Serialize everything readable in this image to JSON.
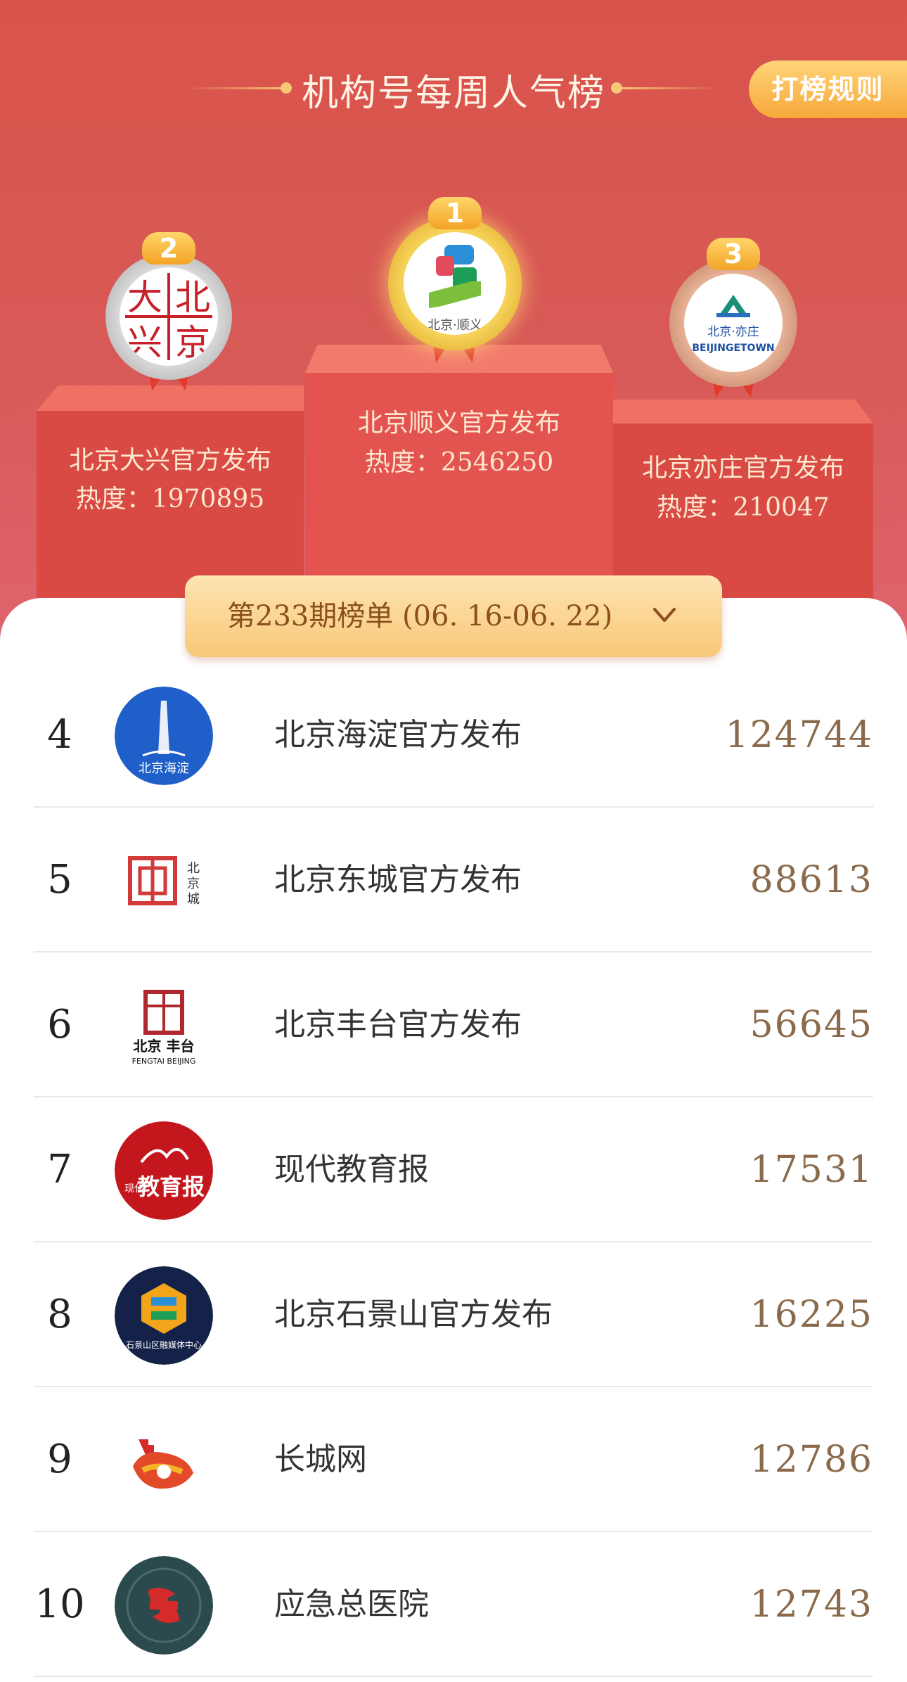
{
  "header": {
    "title": "机构号每周人气榜",
    "rules_label": "打榜规则"
  },
  "podium": {
    "first": {
      "rank": "1",
      "name": "北京顺义官方发布",
      "heat_label": "热度：2546250",
      "logo_text": "北京·顺义"
    },
    "second": {
      "rank": "2",
      "name": "北京大兴官方发布",
      "heat_label": "热度：1970895",
      "logo_chars": [
        "大",
        "北",
        "兴",
        "京"
      ]
    },
    "third": {
      "rank": "3",
      "name": "北京亦庄官方发布",
      "heat_label": "热度：210047",
      "logo_text": "北京·亦庄",
      "logo_sub": "BEIJINGETOWN"
    }
  },
  "period": {
    "label": "第233期榜单 (06. 16-06. 22)"
  },
  "list": [
    {
      "rank": "4",
      "name": "北京海淀官方发布",
      "heat": "124744",
      "logo_text": "北京海淀",
      "icon": "haidian-logo-icon"
    },
    {
      "rank": "5",
      "name": "北京东城官方发布",
      "heat": "88613",
      "logo_text": "北京·东城",
      "icon": "dongcheng-logo-icon"
    },
    {
      "rank": "6",
      "name": "北京丰台官方发布",
      "heat": "56645",
      "logo_text": "北京 丰台",
      "logo_sub": "FENGTAI BEIJING",
      "icon": "fengtai-logo-icon"
    },
    {
      "rank": "7",
      "name": "现代教育报",
      "heat": "17531",
      "logo_text": "教育报",
      "logo_small": "现代",
      "icon": "education-news-logo-icon"
    },
    {
      "rank": "8",
      "name": "北京石景山官方发布",
      "heat": "16225",
      "logo_text": "石景山区融媒体中心",
      "icon": "shijingshan-logo-icon"
    },
    {
      "rank": "9",
      "name": "长城网",
      "heat": "12786",
      "icon": "great-wall-logo-icon"
    },
    {
      "rank": "10",
      "name": "应急总医院",
      "heat": "12743",
      "icon": "hospital-logo-icon"
    }
  ],
  "colors": {
    "hero_red": "#d9534a",
    "gold": "#f7a83a",
    "heat_text": "#8a6a4a"
  }
}
